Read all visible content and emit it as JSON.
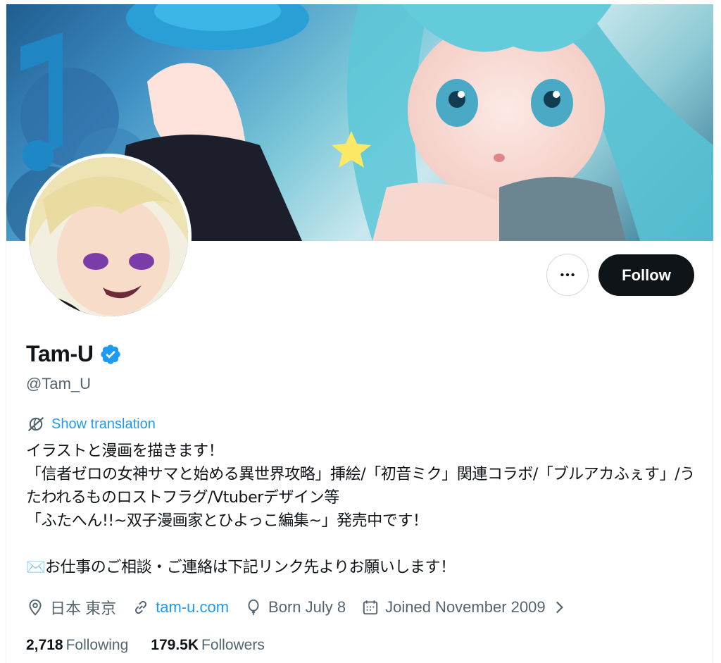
{
  "profile": {
    "display_name": "Tam-U",
    "handle": "@Tam_U",
    "verified": true,
    "show_translation": "Show translation",
    "bio": "イラストと漫画を描きます！\n「信者ゼロの女神サマと始める異世界攻略」挿絵/「初音ミク」関連コラボ/「ブルアカふぇす」/うたわれるものロストフラグ/Vtuberデザイン等\n「ふたへん!!~双子漫画家とひよっこ編集~」発売中です！\n\n✉️お仕事のご相談・ご連絡は下記リンク先よりお願いします！"
  },
  "actions": {
    "follow_label": "Follow",
    "more_icon": "more-horizontal-icon"
  },
  "meta": {
    "location": "日本 東京",
    "website": "tam-u.com",
    "birthday": "Born July 8",
    "joined": "Joined November 2009"
  },
  "stats": {
    "following_count": "2,718",
    "following_label": "Following",
    "followers_count": "179.5K",
    "followers_label": "Followers"
  },
  "colors": {
    "accent": "#1d9bf0",
    "text_primary": "#0f1419",
    "text_secondary": "#536471",
    "follow_bg": "#0f1419"
  }
}
